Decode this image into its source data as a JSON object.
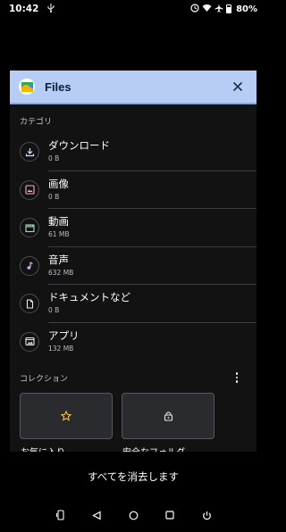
{
  "status_bar": {
    "time": "10:42",
    "usb_icon": "usb-icon",
    "battery_percent": "80%"
  },
  "header": {
    "title": "Files",
    "close_icon": "close-icon"
  },
  "categories": {
    "label": "カテゴリ",
    "items": [
      {
        "name": "ダウンロード",
        "size": "0 B",
        "icon": "download-icon"
      },
      {
        "name": "画像",
        "size": "0 B",
        "icon": "image-icon"
      },
      {
        "name": "動画",
        "size": "61 MB",
        "icon": "video-icon"
      },
      {
        "name": "音声",
        "size": "632 MB",
        "icon": "music-icon"
      },
      {
        "name": "ドキュメントなど",
        "size": "0 B",
        "icon": "document-icon"
      },
      {
        "name": "アプリ",
        "size": "132 MB",
        "icon": "apps-icon"
      }
    ]
  },
  "collections": {
    "label": "コレクション",
    "items": [
      {
        "name": "お気に入り",
        "icon": "star-icon"
      },
      {
        "name": "安全なフォルダ",
        "icon": "lock-icon"
      }
    ]
  },
  "clear_all": "すべてを消去します",
  "colors": {
    "header_bg": "#b7cdf6",
    "accent_yellow": "#f6c343",
    "surface": "#121212"
  }
}
